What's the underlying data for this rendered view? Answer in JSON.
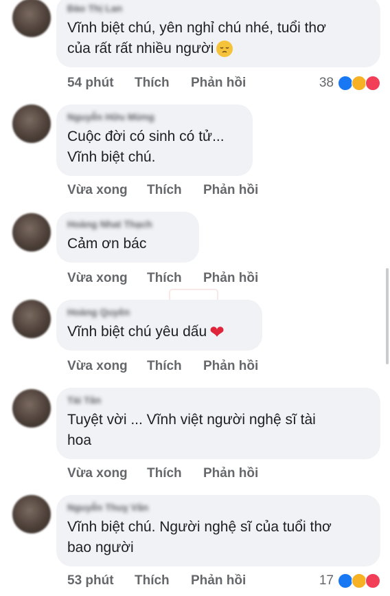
{
  "comments": [
    {
      "author": "Đào Thị Lan",
      "text_lines": [
        "Vĩnh biệt chú, yên nghỉ chú nhé, tuổi thơ",
        "của rất rất nhiều người"
      ],
      "emoji": "pensive-face",
      "time": "54 phút",
      "like": "Thích",
      "reply": "Phản hồi",
      "reaction_count": "38"
    },
    {
      "author": "Nguyễn Hữu Mừng",
      "text_lines": [
        "Cuộc đời có sinh có tử...",
        "Vĩnh biệt chú."
      ],
      "time": "Vừa xong",
      "like": "Thích",
      "reply": "Phản hồi"
    },
    {
      "author": "Hoàng Nhat Thạch",
      "text_lines": [
        "Cảm ơn bác"
      ],
      "time": "Vừa xong",
      "like": "Thích",
      "reply": "Phản hồi"
    },
    {
      "author": "Hoàng Quyên",
      "text_lines": [
        "Vĩnh biệt chú yêu dấu"
      ],
      "emoji": "red-heart",
      "time": "Vừa xong",
      "like": "Thích",
      "reply": "Phản hồi"
    },
    {
      "author": "Tài Tân",
      "text_lines": [
        "Tuyệt vời ... Vĩnh việt người nghệ sĩ tài",
        "hoa"
      ],
      "time": "Vừa xong",
      "like": "Thích",
      "reply": "Phản hồi"
    },
    {
      "author": "Nguyễn Thuỵ Vân",
      "text_lines": [
        "Vĩnh biệt chú. Người nghệ sĩ của tuổi thơ",
        "bao người"
      ],
      "time": "53 phút",
      "like": "Thích",
      "reply": "Phản hồi",
      "reaction_count": "17"
    }
  ],
  "heart_glyph": "❤",
  "reaction_icons": [
    "like-icon",
    "sad-icon",
    "love-icon"
  ],
  "colors": {
    "bubble": "#f0f2f5",
    "meta": "#65676b",
    "like": "#1877f2",
    "love": "#f33e58",
    "sad": "#f7b125"
  }
}
